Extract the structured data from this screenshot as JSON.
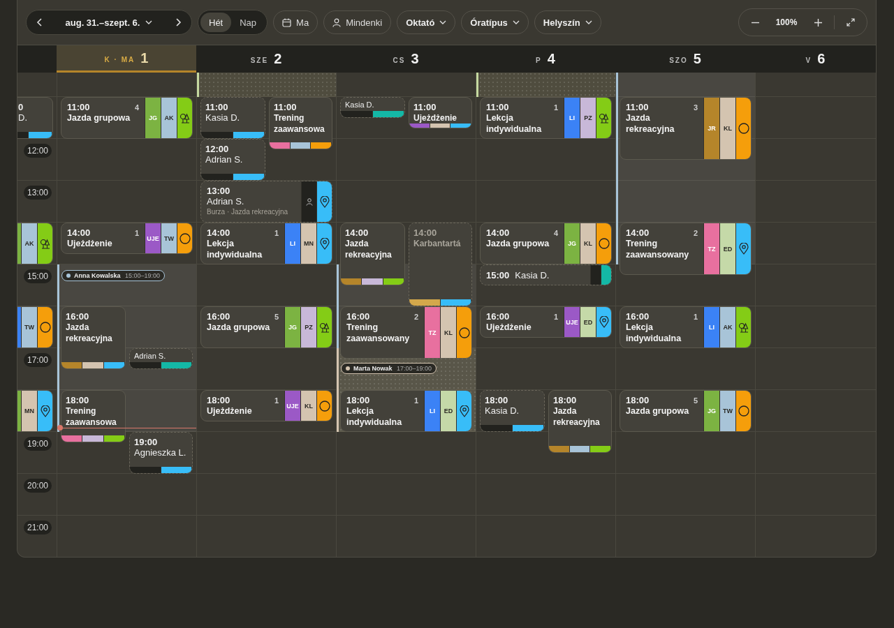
{
  "toolbar": {
    "range": "aug. 31.–szept. 6.",
    "views": [
      {
        "label": "Hét",
        "selected": true
      },
      {
        "label": "Nap",
        "selected": false
      }
    ],
    "today": "Ma",
    "people": "Mindenki",
    "filters": [
      "Oktató",
      "Óratípus",
      "Helyszín"
    ],
    "zoom": "100%"
  },
  "days": [
    {
      "abbr": "K · MA",
      "num": "1",
      "today": true
    },
    {
      "abbr": "SZE",
      "num": "2",
      "today": false
    },
    {
      "abbr": "CS",
      "num": "3",
      "today": false
    },
    {
      "abbr": "P",
      "num": "4",
      "today": false
    },
    {
      "abbr": "SZO",
      "num": "5",
      "today": false
    },
    {
      "abbr": "V",
      "num": "6",
      "today": false
    }
  ],
  "rows": [
    {
      "cells": [
        [],
        [],
        [
          {
            "kind": "dotted-shift",
            "color": "#c5d9a0"
          }
        ],
        [],
        [
          {
            "kind": "dotted-shift",
            "color": "#c5d9a0"
          }
        ],
        [
          {
            "kind": "shift",
            "color": "#a8c4d8"
          }
        ],
        []
      ]
    },
    {
      "cells": [
        [
          {
            "kind": "fragment",
            "lines": [
              "0",
              "D."
            ],
            "stripes": [
              {
                "color": "#22221e"
              },
              {
                "color": "#38bdf8"
              }
            ]
          }
        ],
        [
          {
            "kind": "lesson",
            "time": "11:00",
            "count": "4",
            "title": "Jazda grupowa",
            "tags": [
              {
                "label": "JG",
                "color": "#7cb342"
              },
              {
                "label": "AK",
                "color": "#a8c4d8"
              },
              {
                "kind": "tree",
                "color": "#84cc16"
              }
            ]
          }
        ],
        [
          {
            "kind": "private",
            "time": "11:00",
            "name": "Kasia D.",
            "stripes": [
              {
                "color": "#22221e"
              },
              {
                "color": "#38bdf8"
              }
            ]
          },
          {
            "kind": "striped",
            "time": "11:00",
            "title": "Trening zaawansowa",
            "stripes": [
              {
                "color": "#e8709f"
              },
              {
                "color": "#a8c4d8"
              },
              {
                "color": "#f59e0b"
              }
            ]
          }
        ],
        [
          {
            "kind": "private",
            "name": "Kasia D.",
            "stripes": [
              {
                "color": "#22221e"
              },
              {
                "color": "#14b8a6"
              }
            ]
          },
          {
            "kind": "striped",
            "time": "11:00",
            "title": "Ujeżdżenie",
            "stripes": [
              {
                "color": "#9b59c6"
              },
              {
                "color": "#d4c4b0"
              },
              {
                "color": "#38bdf8"
              }
            ]
          }
        ],
        [
          {
            "kind": "lesson",
            "time": "11:00",
            "count": "1",
            "title": "Lekcja indywidualna",
            "tags": [
              {
                "label": "LI",
                "color": "#3b82f6"
              },
              {
                "label": "PZ",
                "color": "#c8b8d8"
              },
              {
                "kind": "tree",
                "color": "#84cc16"
              }
            ]
          }
        ],
        [
          {
            "kind": "lesson",
            "time": "11:00",
            "count": "3",
            "title": "Jazda rekreacyjna",
            "tags": [
              {
                "label": "JR",
                "color": "#b5852a"
              },
              {
                "label": "KL",
                "color": "#d4c4b0"
              },
              {
                "kind": "circle",
                "color": "#f59e0b"
              }
            ]
          }
        ],
        []
      ]
    },
    {
      "label": "12:00",
      "cells": [
        [],
        [],
        [
          {
            "kind": "private",
            "time": "12:00",
            "name": "Adrian S.",
            "stripes": [
              {
                "color": "#22221e"
              },
              {
                "color": "#38bdf8"
              }
            ]
          }
        ],
        [],
        [],
        [],
        []
      ]
    },
    {
      "label": "13:00",
      "cells": [
        [],
        [],
        [
          {
            "kind": "booking",
            "time": "13:00",
            "name": "Adrian S.",
            "note": "Burza · Jazda rekreacyjna",
            "tags": [
              {
                "kind": "person",
                "color": "#22221e"
              },
              {
                "kind": "pin",
                "color": "#38bdf8"
              }
            ]
          }
        ],
        [],
        [],
        [],
        []
      ]
    },
    {
      "cells": [
        [
          {
            "kind": "fragment",
            "tags": [
              {
                "color": "#7cb342"
              },
              {
                "label": "AK",
                "color": "#a8c4d8"
              },
              {
                "kind": "tree",
                "color": "#84cc16"
              }
            ]
          }
        ],
        [
          {
            "kind": "lesson",
            "time": "14:00",
            "count": "1",
            "title": "Ujeżdżenie",
            "tags": [
              {
                "label": "UJE",
                "color": "#9b59c6"
              },
              {
                "label": "TW",
                "color": "#a8c4d8"
              },
              {
                "kind": "circle",
                "color": "#f59e0b"
              }
            ]
          }
        ],
        [
          {
            "kind": "lesson",
            "time": "14:00",
            "count": "1",
            "title": "Lekcja indywidualna",
            "tags": [
              {
                "label": "LI",
                "color": "#3b82f6"
              },
              {
                "label": "MN",
                "color": "#d4c4b0"
              },
              {
                "kind": "pin",
                "color": "#38bdf8"
              }
            ]
          }
        ],
        [
          {
            "kind": "striped",
            "time": "14:00",
            "title": "Jazda rekreacyjna",
            "stripes": [
              {
                "color": "#b5852a"
              },
              {
                "color": "#c8b8d8"
              },
              {
                "color": "#84cc16"
              }
            ]
          },
          {
            "kind": "maintenance",
            "time": "14:00",
            "title": "Karbantartá",
            "stripes": [
              {
                "color": "#d4a84b"
              },
              {
                "color": "#38bdf8"
              }
            ]
          }
        ],
        [
          {
            "kind": "lesson",
            "time": "14:00",
            "count": "4",
            "title": "Jazda grupowa",
            "tags": [
              {
                "label": "JG",
                "color": "#7cb342"
              },
              {
                "label": "KL",
                "color": "#d4c4b0"
              },
              {
                "kind": "circle",
                "color": "#f59e0b"
              }
            ]
          }
        ],
        [
          {
            "kind": "lesson",
            "time": "14:00",
            "count": "2",
            "title": "Trening zaawansowany",
            "tags": [
              {
                "label": "TZ",
                "color": "#e8709f"
              },
              {
                "label": "ED",
                "color": "#c5d9a8"
              },
              {
                "kind": "pin",
                "color": "#38bdf8"
              }
            ]
          }
        ],
        []
      ]
    },
    {
      "label": "15:00",
      "cells": [
        [],
        [
          {
            "kind": "shift",
            "color": "#a8c4d8",
            "name": "Anna Kowalska",
            "hours": "15:00–19:00"
          }
        ],
        [],
        [
          {
            "kind": "shift",
            "color": "#a8c4d8"
          }
        ],
        [
          {
            "kind": "inline",
            "time": "15:00",
            "name": "Kasia D.",
            "tags": [
              {
                "color": "#22221e"
              },
              {
                "color": "#14b8a6"
              }
            ]
          }
        ],
        [],
        []
      ]
    },
    {
      "cells": [
        [
          {
            "kind": "fragment",
            "tags": [
              {
                "color": "#3b82f6"
              },
              {
                "label": "TW",
                "color": "#a8c4d8"
              },
              {
                "kind": "circle",
                "color": "#f59e0b"
              }
            ]
          }
        ],
        [
          {
            "kind": "striped",
            "time": "16:00",
            "title": "Jazda rekreacyjna",
            "stripes": [
              {
                "color": "#b5852a"
              },
              {
                "color": "#d4c4b0"
              },
              {
                "color": "#38bdf8"
              }
            ]
          }
        ],
        [
          {
            "kind": "lesson",
            "time": "16:00",
            "count": "5",
            "title": "Jazda grupowa",
            "tags": [
              {
                "label": "JG",
                "color": "#7cb342"
              },
              {
                "label": "PZ",
                "color": "#c8b8d8"
              },
              {
                "kind": "tree",
                "color": "#84cc16"
              }
            ]
          }
        ],
        [
          {
            "kind": "lesson",
            "time": "16:00",
            "count": "2",
            "title": "Trening zaawansowany",
            "tags": [
              {
                "label": "TZ",
                "color": "#e8709f"
              },
              {
                "label": "KL",
                "color": "#d4c4b0"
              },
              {
                "kind": "circle",
                "color": "#f59e0b"
              }
            ]
          }
        ],
        [
          {
            "kind": "lesson",
            "time": "16:00",
            "count": "1",
            "title": "Ujeżdżenie",
            "tags": [
              {
                "label": "UJE",
                "color": "#9b59c6"
              },
              {
                "label": "ED",
                "color": "#c5d9a8"
              },
              {
                "kind": "pin",
                "color": "#38bdf8"
              }
            ]
          }
        ],
        [
          {
            "kind": "lesson",
            "time": "16:00",
            "count": "1",
            "title": "Lekcja indywidualna",
            "tags": [
              {
                "label": "LI",
                "color": "#3b82f6"
              },
              {
                "label": "AK",
                "color": "#a8c4d8"
              },
              {
                "kind": "tree",
                "color": "#84cc16"
              }
            ]
          }
        ],
        []
      ]
    },
    {
      "label": "17:00",
      "cells": [
        [],
        [
          {
            "kind": "private",
            "name": "Adrian S.",
            "stripes": [
              {
                "color": "#22221e"
              },
              {
                "color": "#14b8a6"
              }
            ]
          }
        ],
        [],
        [
          {
            "kind": "dotted-shift",
            "color": "#d4c4b0",
            "name": "Marta Nowak",
            "hours": "17:00–19:00"
          }
        ],
        [],
        [],
        []
      ]
    },
    {
      "cells": [
        [
          {
            "kind": "fragment",
            "tags": [
              {
                "color": "#7cb342"
              },
              {
                "label": "MN",
                "color": "#d4c4b0"
              },
              {
                "kind": "pin",
                "color": "#38bdf8"
              }
            ]
          }
        ],
        [
          {
            "kind": "striped",
            "time": "18:00",
            "title": "Trening zaawansowa",
            "stripes": [
              {
                "color": "#e8709f"
              },
              {
                "color": "#c8b8d8"
              },
              {
                "color": "#84cc16"
              }
            ]
          },
          {
            "kind": "now"
          }
        ],
        [
          {
            "kind": "lesson",
            "time": "18:00",
            "count": "1",
            "title": "Ujeżdżenie",
            "tags": [
              {
                "label": "UJE",
                "color": "#9b59c6"
              },
              {
                "label": "KL",
                "color": "#d4c4b0"
              },
              {
                "kind": "circle",
                "color": "#f59e0b"
              }
            ]
          }
        ],
        [
          {
            "kind": "lesson",
            "time": "18:00",
            "count": "1",
            "title": "Lekcja indywidualna",
            "tags": [
              {
                "label": "LI",
                "color": "#3b82f6"
              },
              {
                "label": "ED",
                "color": "#c5d9a8"
              },
              {
                "kind": "pin",
                "color": "#38bdf8"
              }
            ]
          }
        ],
        [
          {
            "kind": "private",
            "time": "18:00",
            "name": "Kasia D.",
            "stripes": [
              {
                "color": "#22221e"
              },
              {
                "color": "#38bdf8"
              }
            ]
          },
          {
            "kind": "striped",
            "time": "18:00",
            "title": "Jazda rekreacyjna",
            "stripes": [
              {
                "color": "#b5852a"
              },
              {
                "color": "#a8c4d8"
              },
              {
                "color": "#84cc16"
              }
            ]
          }
        ],
        [
          {
            "kind": "lesson",
            "time": "18:00",
            "count": "5",
            "title": "Jazda grupowa",
            "tags": [
              {
                "label": "JG",
                "color": "#7cb342"
              },
              {
                "label": "TW",
                "color": "#a8c4d8"
              },
              {
                "kind": "circle",
                "color": "#f59e0b"
              }
            ]
          }
        ],
        []
      ]
    },
    {
      "label": "19:00",
      "cells": [
        [],
        [
          {
            "kind": "private",
            "time": "19:00",
            "name": "Agnieszka L.",
            "stripes": [
              {
                "color": "#22221e"
              },
              {
                "color": "#38bdf8"
              }
            ]
          }
        ],
        [],
        [],
        [],
        [],
        []
      ]
    },
    {
      "label": "20:00",
      "cells": [
        [],
        [],
        [],
        [],
        [],
        [],
        []
      ]
    },
    {
      "label": "21:00",
      "cells": [
        [],
        [],
        [],
        [],
        [],
        [],
        []
      ]
    }
  ]
}
